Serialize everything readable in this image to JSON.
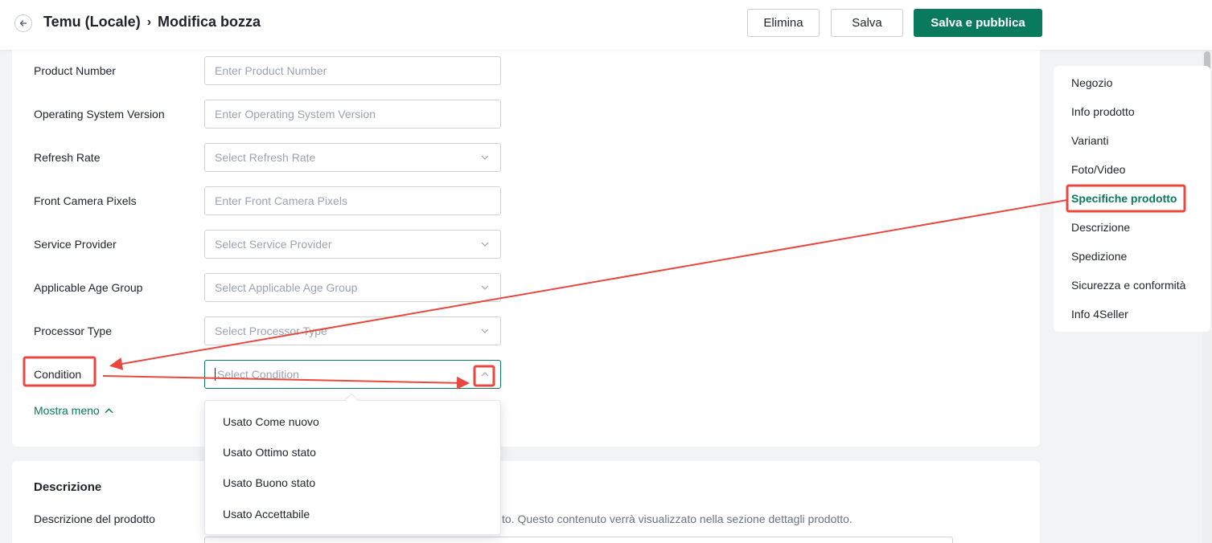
{
  "header": {
    "breadcrumb_root": "Temu (Locale)",
    "breadcrumb_sep": "›",
    "breadcrumb_current": "Modifica bozza",
    "delete_label": "Elimina",
    "save_label": "Salva",
    "publish_label": "Salva e pubblica"
  },
  "fields": [
    {
      "label": "Product Number",
      "placeholder": "Enter Product Number",
      "type": "input"
    },
    {
      "label": "Operating System Version",
      "placeholder": "Enter Operating System Version",
      "type": "input"
    },
    {
      "label": "Refresh Rate",
      "placeholder": "Select Refresh Rate",
      "type": "select"
    },
    {
      "label": "Front Camera Pixels",
      "placeholder": "Enter Front Camera Pixels",
      "type": "input"
    },
    {
      "label": "Service Provider",
      "placeholder": "Select Service Provider",
      "type": "select"
    },
    {
      "label": "Applicable Age Group",
      "placeholder": "Select Applicable Age Group",
      "type": "select"
    },
    {
      "label": "Processor Type",
      "placeholder": "Select Processor Type",
      "type": "select"
    },
    {
      "label": "Condition",
      "placeholder": "Select Condition",
      "type": "select-open"
    }
  ],
  "show_less_label": "Mostra meno",
  "condition_options": [
    "Usato Come nuovo",
    "Usato Ottimo stato",
    "Usato Buono stato",
    "Usato Accettabile"
  ],
  "description": {
    "title": "Descrizione",
    "label": "Descrizione del prodotto",
    "help_text": "to. Questo contenuto verrà visualizzato nella sezione dettagli prodotto."
  },
  "nav": {
    "items": [
      "Negozio",
      "Info prodotto",
      "Varianti",
      "Foto/Video",
      "Specifiche prodotto",
      "Descrizione",
      "Spedizione",
      "Sicurezza e conformità",
      "Info 4Seller"
    ],
    "active": "Specifiche prodotto"
  },
  "colors": {
    "accent": "#0a7a5c",
    "annotation": "#e8483f"
  }
}
